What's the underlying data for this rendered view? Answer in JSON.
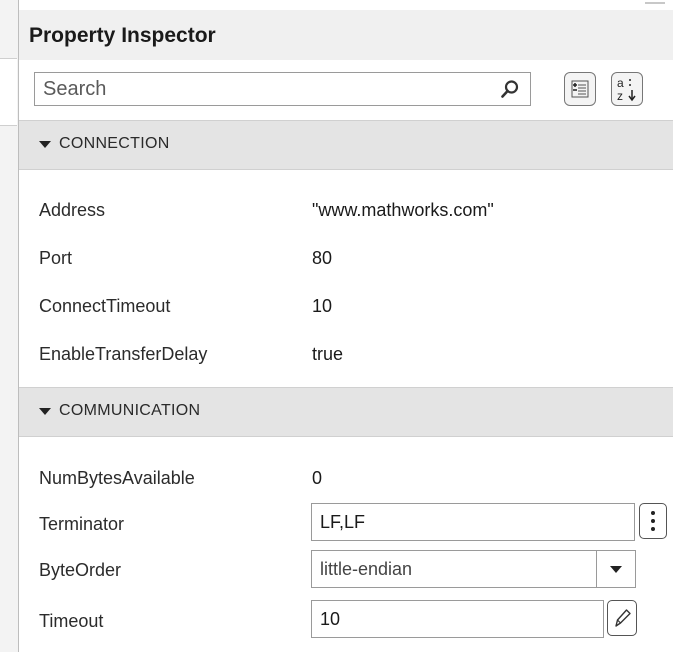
{
  "panel": {
    "title": "Property Inspector"
  },
  "search": {
    "placeholder": "Search",
    "icon": "magnifier-icon"
  },
  "toolbar": {
    "categorize_icon": "categorized-list-icon",
    "alphabetize_icon": "sort-alphabetical-icon"
  },
  "sections": {
    "connection": {
      "label": "CONNECTION",
      "properties": [
        {
          "name": "Address",
          "value": "\"www.mathworks.com\""
        },
        {
          "name": "Port",
          "value": "80"
        },
        {
          "name": "ConnectTimeout",
          "value": "10"
        },
        {
          "name": "EnableTransferDelay",
          "value": "true"
        }
      ]
    },
    "communication": {
      "label": "COMMUNICATION",
      "properties": [
        {
          "name": "NumBytesAvailable",
          "value": "0"
        },
        {
          "name": "Terminator",
          "value": "LF,LF"
        },
        {
          "name": "ByteOrder",
          "value": "little-endian"
        },
        {
          "name": "Timeout",
          "value": "10"
        }
      ]
    }
  },
  "colors": {
    "header_bg": "#f0f0f0",
    "section_bg": "#e4e4e4",
    "border": "#9a9a9a"
  }
}
